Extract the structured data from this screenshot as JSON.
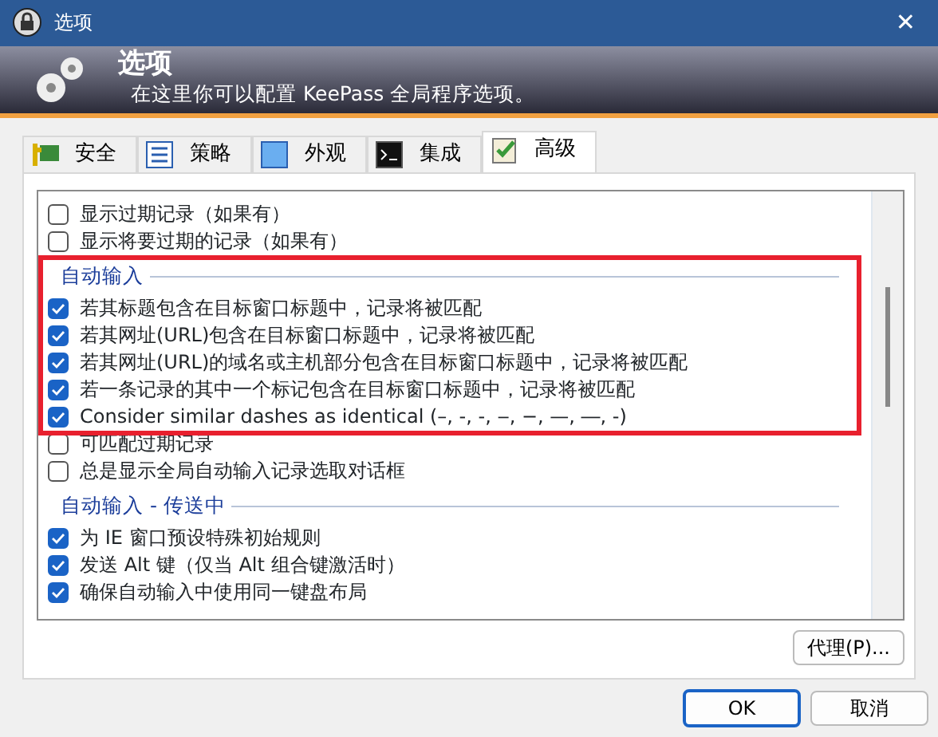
{
  "window": {
    "title": "选项",
    "close": "✕"
  },
  "banner": {
    "title": "选项",
    "subtitle": "在这里你可以配置 KeePass 全局程序选项。"
  },
  "tabs": [
    {
      "label": "安全",
      "selected": false
    },
    {
      "label": "策略",
      "selected": false
    },
    {
      "label": "外观",
      "selected": false
    },
    {
      "label": "集成",
      "selected": false
    },
    {
      "label": "高级",
      "selected": true
    }
  ],
  "options": [
    {
      "kind": "checkbox",
      "label": "显示过期记录（如果有）",
      "checked": false
    },
    {
      "kind": "checkbox",
      "label": "显示将要过期的记录（如果有）",
      "checked": false
    },
    {
      "kind": "group",
      "label": "自动输入",
      "highlighted": true
    },
    {
      "kind": "checkbox",
      "label": "若其标题包含在目标窗口标题中，记录将被匹配",
      "checked": true,
      "highlighted": true
    },
    {
      "kind": "checkbox",
      "label": "若其网址(URL)包含在目标窗口标题中，记录将被匹配",
      "checked": true,
      "highlighted": true
    },
    {
      "kind": "checkbox",
      "label": "若其网址(URL)的域名或主机部分包含在目标窗口标题中，记录将被匹配",
      "checked": true,
      "highlighted": true
    },
    {
      "kind": "checkbox",
      "label": "若一条记录的其中一个标记包含在目标窗口标题中，记录将被匹配",
      "checked": true,
      "highlighted": true
    },
    {
      "kind": "checkbox",
      "label": "Consider similar dashes as identical (–, ‑, ‐, ‒, −, —, ―, -)",
      "checked": true,
      "highlighted": true
    },
    {
      "kind": "checkbox",
      "label": "可匹配过期记录",
      "checked": false
    },
    {
      "kind": "checkbox",
      "label": "总是显示全局自动输入记录选取对话框",
      "checked": false
    },
    {
      "kind": "group",
      "label": "自动输入 - 传送中"
    },
    {
      "kind": "checkbox",
      "label": "为 IE 窗口预设特殊初始规则",
      "checked": true
    },
    {
      "kind": "checkbox",
      "label": "发送 Alt 键（仅当 Alt 组合键激活时）",
      "checked": true
    },
    {
      "kind": "checkbox",
      "label": "确保自动输入中使用同一键盘布局",
      "checked": true
    }
  ],
  "proxy_button": "代理(P)...",
  "buttons": [
    {
      "label": "OK",
      "default": true
    },
    {
      "label": "取消",
      "default": false
    }
  ]
}
